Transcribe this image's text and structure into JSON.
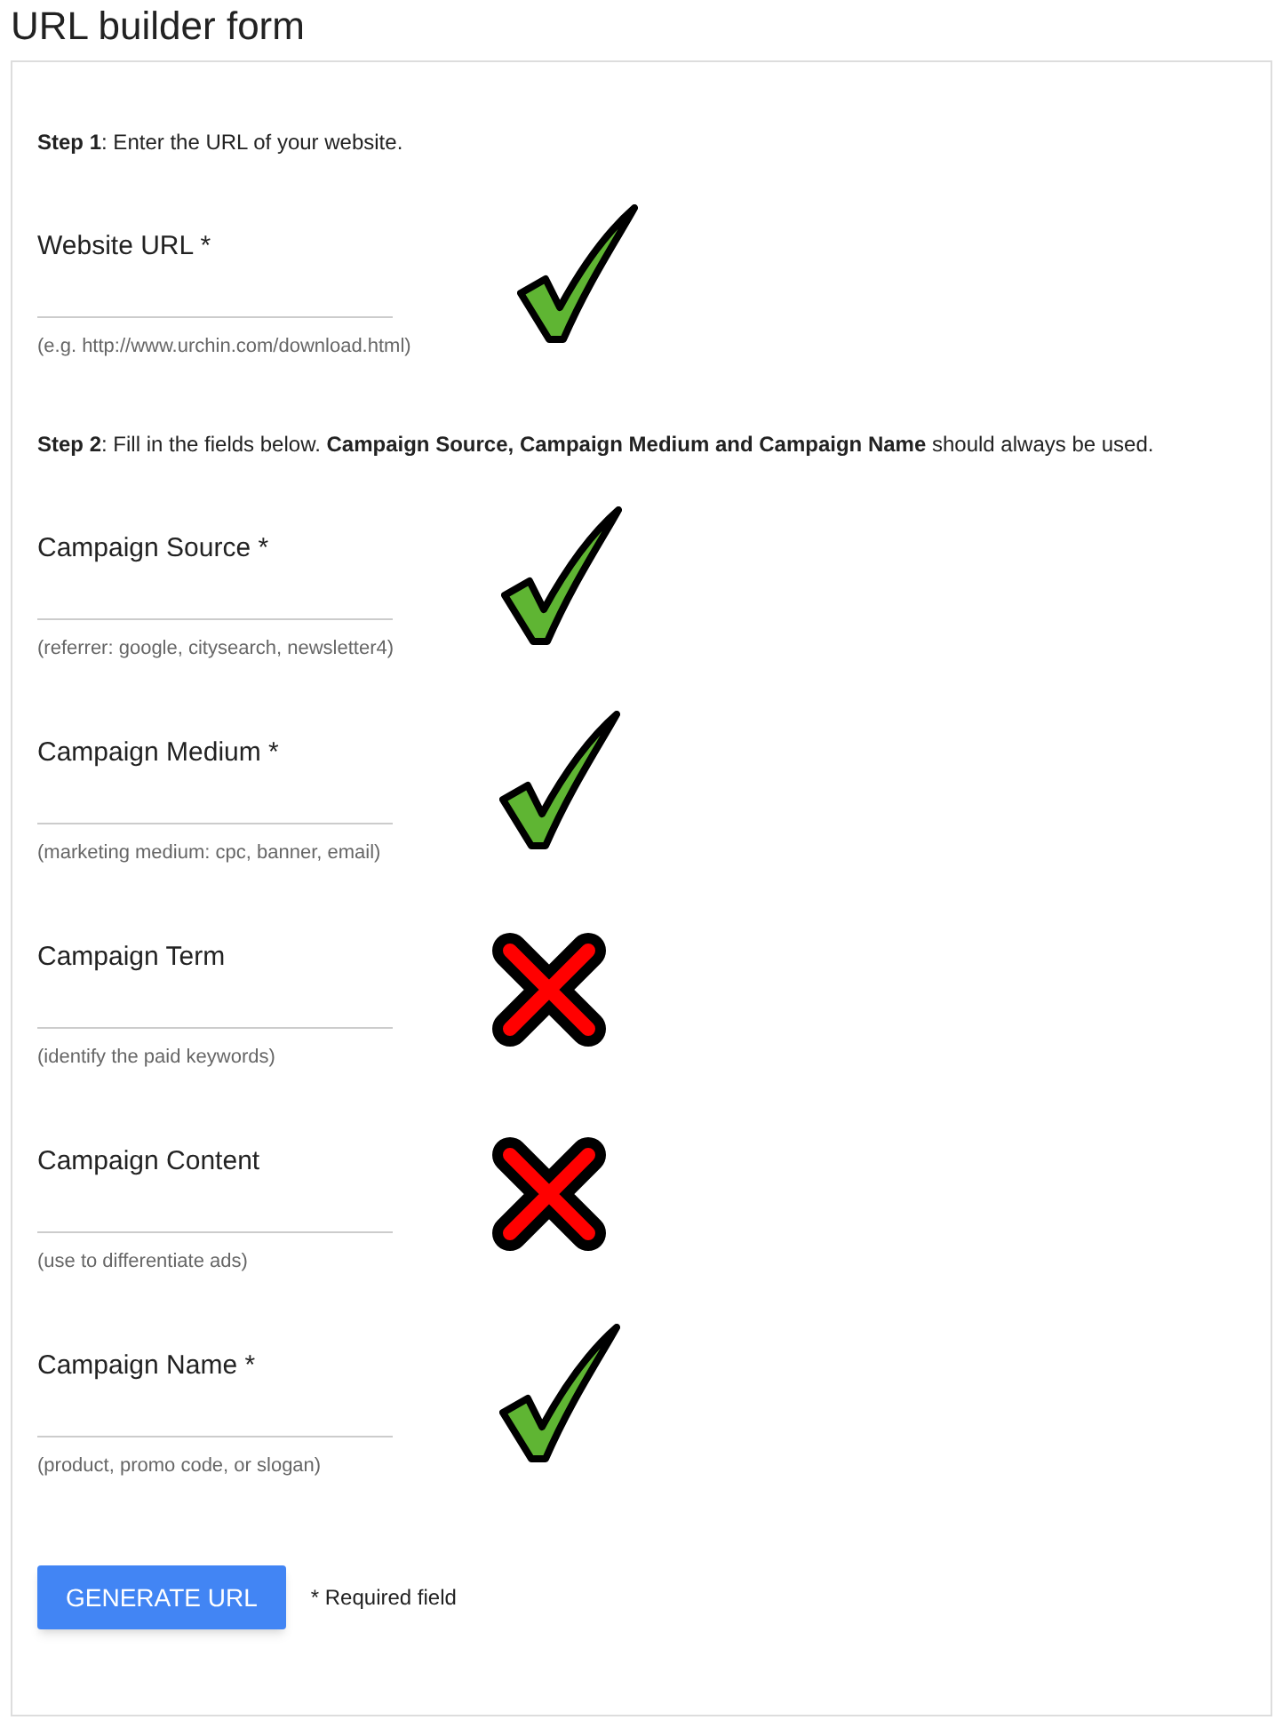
{
  "title": "URL builder form",
  "step1": "**Step 1**: Enter the URL of your website.",
  "fields_1": [
    {
      "label": "Website URL *",
      "hint": "(e.g. http://www.urchin.com/download.html)",
      "kind": "check"
    }
  ],
  "step2": "**Step 2**: Fill in the fields below. **Campaign Source, Campaign Medium and Campaign Name** should always be used.",
  "fields_2": [
    {
      "label": "Campaign Source *",
      "hint": "(referrer: google, citysearch, newsletter4)",
      "kind": "check"
    },
    {
      "label": "Campaign Medium *",
      "hint": "(marketing medium: cpc, banner, email)",
      "kind": "check"
    },
    {
      "label": "Campaign Term",
      "hint": "(identify the paid keywords)",
      "kind": "cross"
    },
    {
      "label": "Campaign Content",
      "hint": "(use to differentiate ads)",
      "kind": "cross"
    },
    {
      "label": "Campaign Name *",
      "hint": "(product, promo code, or slogan)",
      "kind": "check"
    }
  ],
  "button": "GENERATE URL",
  "note": "* Required field"
}
